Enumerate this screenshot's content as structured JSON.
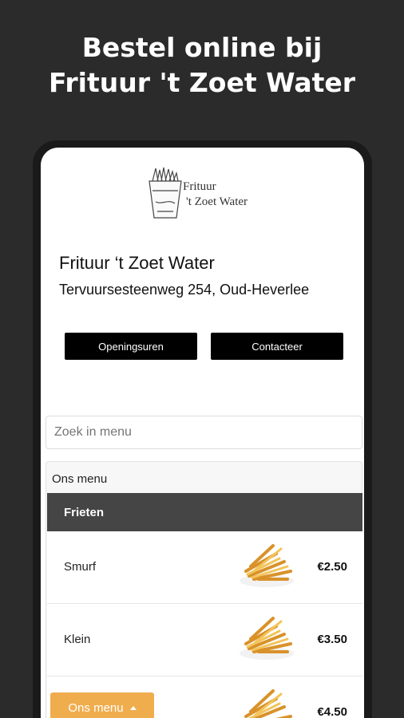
{
  "promo": {
    "line1": "Bestel online bij",
    "line2": "Frituur 't Zoet Water"
  },
  "logo": {
    "line1": "Frituur",
    "line2": "'t Zoet Water",
    "icon": "fries-cone-icon"
  },
  "shop": {
    "name": "Frituur ‘t Zoet Water",
    "address": "Tervuursesteenweg 254, Oud-Heverlee"
  },
  "buttons": {
    "hours": "Openingsuren",
    "contact": "Contacteer"
  },
  "search": {
    "placeholder": "Zoek in menu"
  },
  "menu": {
    "title": "Ons menu",
    "category": "Frieten",
    "items": [
      {
        "name": "Smurf",
        "price": "€2.50",
        "icon": "fries-icon"
      },
      {
        "name": "Klein",
        "price": "€3.50",
        "icon": "fries-icon"
      },
      {
        "name": "",
        "price": "€4.50",
        "icon": "fries-icon"
      }
    ]
  },
  "floating_menu": {
    "label": "Ons menu",
    "icon": "caret-up-icon"
  },
  "colors": {
    "background": "#2b2b2c",
    "accent": "#f0ad4e",
    "category_header": "#454545"
  }
}
